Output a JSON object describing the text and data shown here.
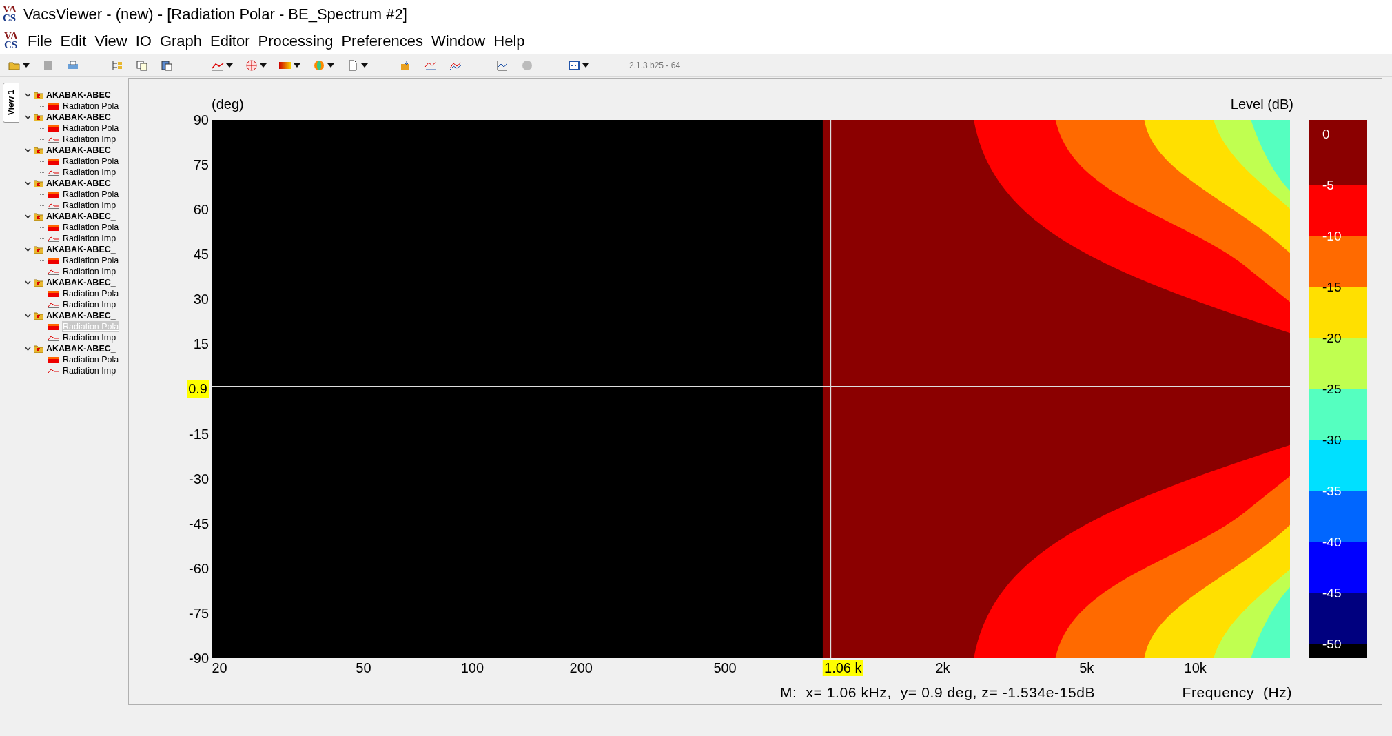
{
  "window": {
    "logo": {
      "top": "VA",
      "bottom": "CS"
    },
    "title": "VacsViewer - (new) - [Radiation Polar - BE_Spectrum #2]"
  },
  "menu": {
    "logo": {
      "top": "VA",
      "bottom": "CS"
    },
    "items": [
      "File",
      "Edit",
      "View",
      "IO",
      "Graph",
      "Editor",
      "Processing",
      "Preferences",
      "Window",
      "Help"
    ]
  },
  "toolbar": {
    "version": "2.1.3 b25 - 64"
  },
  "side_tab": {
    "label": "View 1",
    "selected": true
  },
  "tree": [
    {
      "label": "AKABAK-ABEC_",
      "expanded": true,
      "children": [
        {
          "label": "Radiation Pola",
          "kind": "contour",
          "selected": false
        }
      ]
    },
    {
      "label": "AKABAK-ABEC_",
      "expanded": true,
      "children": [
        {
          "label": "Radiation Pola",
          "kind": "contour",
          "selected": false
        },
        {
          "label": "Radiation Imp",
          "kind": "line",
          "selected": false
        }
      ]
    },
    {
      "label": "AKABAK-ABEC_",
      "expanded": true,
      "children": [
        {
          "label": "Radiation Pola",
          "kind": "contour",
          "selected": false
        },
        {
          "label": "Radiation Imp",
          "kind": "line",
          "selected": false
        }
      ]
    },
    {
      "label": "AKABAK-ABEC_",
      "expanded": true,
      "children": [
        {
          "label": "Radiation Pola",
          "kind": "contour",
          "selected": false
        },
        {
          "label": "Radiation Imp",
          "kind": "line",
          "selected": false
        }
      ]
    },
    {
      "label": "AKABAK-ABEC_",
      "expanded": true,
      "children": [
        {
          "label": "Radiation Pola",
          "kind": "contour",
          "selected": false
        },
        {
          "label": "Radiation Imp",
          "kind": "line",
          "selected": false
        }
      ]
    },
    {
      "label": "AKABAK-ABEC_",
      "expanded": true,
      "children": [
        {
          "label": "Radiation Pola",
          "kind": "contour",
          "selected": false
        },
        {
          "label": "Radiation Imp",
          "kind": "line",
          "selected": false
        }
      ]
    },
    {
      "label": "AKABAK-ABEC_",
      "expanded": true,
      "children": [
        {
          "label": "Radiation Pola",
          "kind": "contour",
          "selected": false
        },
        {
          "label": "Radiation Imp",
          "kind": "line",
          "selected": false
        }
      ]
    },
    {
      "label": "AKABAK-ABEC_",
      "expanded": true,
      "children": [
        {
          "label": "Radiation Pola",
          "kind": "contour",
          "selected": true
        },
        {
          "label": "Radiation Imp",
          "kind": "line",
          "selected": false
        }
      ]
    },
    {
      "label": "AKABAK-ABEC_",
      "expanded": true,
      "children": [
        {
          "label": "Radiation Pola",
          "kind": "contour",
          "selected": false
        },
        {
          "label": "Radiation Imp",
          "kind": "line",
          "selected": false
        }
      ]
    }
  ],
  "plot": {
    "y_axis_label": "(deg)",
    "colorbar_label": "Level  (dB)",
    "y_ticks": [
      {
        "label": "90",
        "kind": "tick"
      },
      {
        "label": "75",
        "kind": "tick"
      },
      {
        "label": "60",
        "kind": "tick"
      },
      {
        "label": "45",
        "kind": "tick"
      },
      {
        "label": "30",
        "kind": "tick"
      },
      {
        "label": "15",
        "kind": "tick"
      },
      {
        "label": "0.9",
        "kind": "cursor"
      },
      {
        "label": "-15",
        "kind": "tick"
      },
      {
        "label": "-30",
        "kind": "tick"
      },
      {
        "label": "-45",
        "kind": "tick"
      },
      {
        "label": "-60",
        "kind": "tick"
      },
      {
        "label": "-75",
        "kind": "tick"
      },
      {
        "label": "-90",
        "kind": "tick"
      }
    ],
    "x_ticks": [
      {
        "label": "20",
        "kind": "tick"
      },
      {
        "label": "50",
        "kind": "tick"
      },
      {
        "label": "100",
        "kind": "tick"
      },
      {
        "label": "200",
        "kind": "tick"
      },
      {
        "label": "500",
        "kind": "tick"
      },
      {
        "label": "1.06 k",
        "kind": "cursor"
      },
      {
        "label": "2k",
        "kind": "tick"
      },
      {
        "label": "5k",
        "kind": "tick"
      },
      {
        "label": "10k",
        "kind": "tick"
      }
    ],
    "cursor_readout": "M:  x= 1.06 kHz,  y= 0.9 deg, z= -1.534e-15dB",
    "x_axis_label": "Frequency  (Hz)",
    "colorbar": {
      "labels": [
        "0",
        "-5",
        "-10",
        "-15",
        "-20",
        "-25",
        "-30",
        "-35",
        "-40",
        "-45",
        "-50"
      ],
      "bands": [
        {
          "color": "#8b0000"
        },
        {
          "color": "#ff0000"
        },
        {
          "color": "#ff6a00"
        },
        {
          "color": "#ffe000"
        },
        {
          "color": "#c0ff50"
        },
        {
          "color": "#55ffc0"
        },
        {
          "color": "#00e0ff"
        },
        {
          "color": "#0066ff"
        },
        {
          "color": "#0000ff"
        },
        {
          "color": "#00007f"
        },
        {
          "color": "#000000"
        }
      ]
    }
  }
}
